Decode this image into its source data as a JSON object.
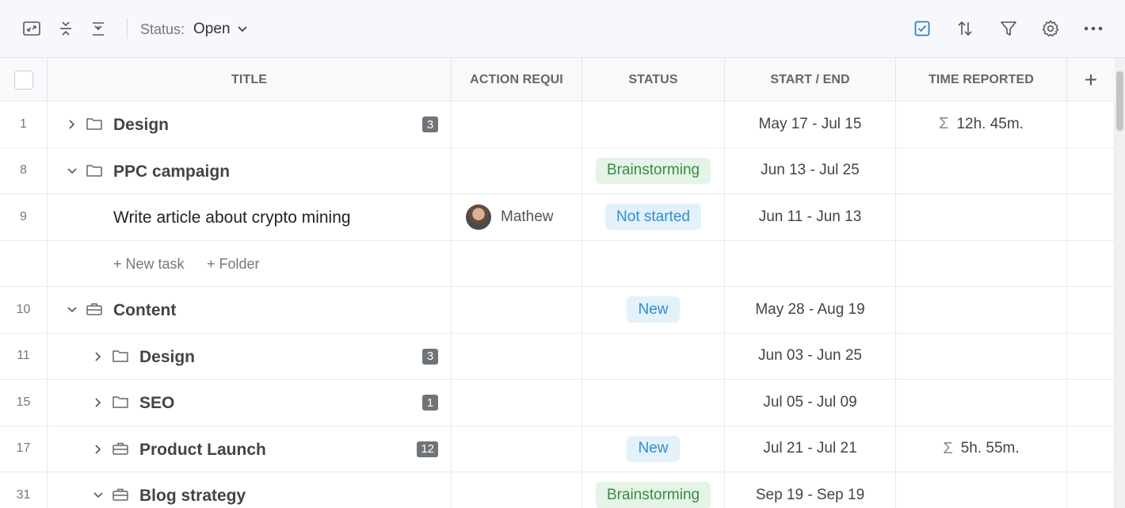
{
  "toolbar": {
    "status_label": "Status:",
    "status_value": "Open"
  },
  "columns": {
    "title": "TITLE",
    "action": "ACTION REQUI",
    "status": "STATUS",
    "dates": "START / END",
    "time": "TIME REPORTED",
    "add": "+"
  },
  "rows": [
    {
      "num": "1",
      "title": "Design",
      "count": "3",
      "dates": "May 17 - Jul 15",
      "time": "12h. 45m."
    },
    {
      "num": "8",
      "title": "PPC campaign",
      "status": "Brainstorming",
      "dates": "Jun 13 - Jul 25"
    },
    {
      "num": "9",
      "title": "Write article about crypto mining",
      "assignee": "Mathew",
      "status": "Not started",
      "dates": "Jun 11 - Jun 13"
    },
    {
      "new_task": "+ New task",
      "new_folder": "+ Folder"
    },
    {
      "num": "10",
      "title": "Content",
      "status": "New",
      "dates": "May 28 - Aug 19"
    },
    {
      "num": "11",
      "title": "Design",
      "count": "3",
      "dates": "Jun 03 - Jun 25"
    },
    {
      "num": "15",
      "title": "SEO",
      "count": "1",
      "dates": "Jul 05 - Jul 09"
    },
    {
      "num": "17",
      "title": "Product Launch",
      "count": "12",
      "status": "New",
      "dates": "Jul 21 - Jul 21",
      "time": "5h. 55m."
    },
    {
      "num": "31",
      "title": "Blog strategy",
      "status": "Brainstorming",
      "dates": "Sep 19 - Sep 19"
    }
  ],
  "sigma": "Σ"
}
